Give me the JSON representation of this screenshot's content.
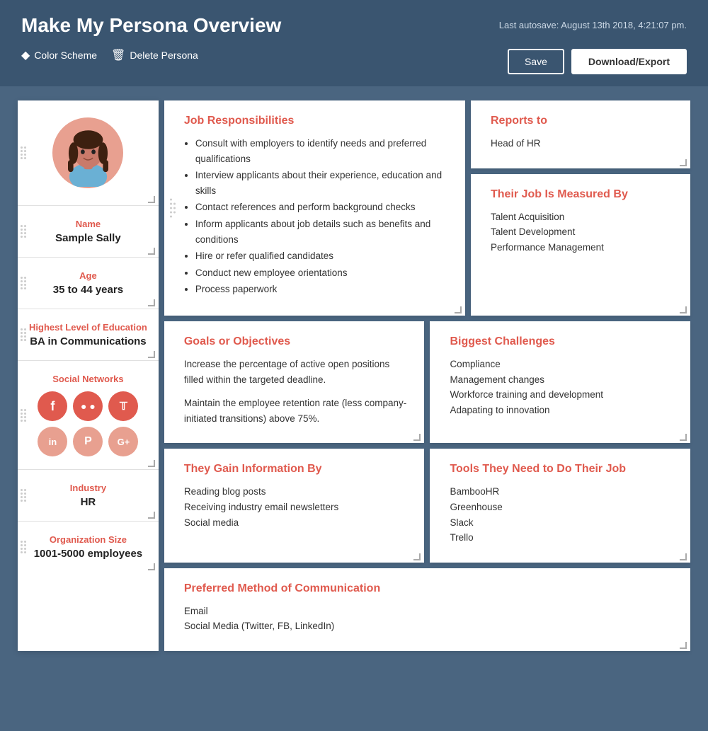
{
  "header": {
    "title": "Make My Persona Overview",
    "autosave": "Last autosave: August 13th 2018, 4:21:07 pm.",
    "color_scheme_label": "Color Scheme",
    "delete_persona_label": "Delete Persona",
    "save_button": "Save",
    "download_button": "Download/Export"
  },
  "persona": {
    "name_label": "Name",
    "name_value": "Sample Sally",
    "age_label": "Age",
    "age_value": "35 to 44 years",
    "education_label": "Highest Level of Education",
    "education_value": "BA in Communications",
    "social_label": "Social Networks",
    "social_icons": [
      "f",
      "&#x1D4F8;",
      "&#x1D54B;",
      "in",
      "&#x1D4C5;",
      "G+"
    ],
    "industry_label": "Industry",
    "industry_value": "HR",
    "org_size_label": "Organization Size",
    "org_size_value": "1001-5000 employees"
  },
  "job_responsibilities": {
    "title": "Job Responsibilities",
    "items": [
      "Consult with employers to identify needs and preferred qualifications",
      "Interview applicants about their experience, education and skills",
      "Contact references and perform background checks",
      "Inform applicants about job details such as benefits and conditions",
      "Hire or refer qualified candidates",
      "Conduct new employee orientations",
      "Process paperwork"
    ]
  },
  "reports_to": {
    "title": "Reports to",
    "value": "Head of HR"
  },
  "measured_by": {
    "title": "Their Job Is Measured By",
    "items": [
      "Talent Acquisition",
      "Talent Development",
      "Performance Management"
    ]
  },
  "goals": {
    "title": "Goals or Objectives",
    "paragraphs": [
      "Increase the percentage of active open positions filled within the targeted deadline.",
      "Maintain the employee retention rate (less company-initiated transitions) above 75%."
    ]
  },
  "challenges": {
    "title": "Biggest Challenges",
    "items": [
      "Compliance",
      "Management changes",
      "Workforce training and development",
      "Adapating to innovation"
    ]
  },
  "gain_info": {
    "title": "They Gain Information By",
    "items": [
      "Reading blog posts",
      "Receiving industry email newsletters",
      "Social media"
    ]
  },
  "tools": {
    "title": "Tools They Need to Do Their Job",
    "items": [
      "BambooHR",
      "Greenhouse",
      "Slack",
      "Trello"
    ]
  },
  "communication": {
    "title": "Preferred Method of Communication",
    "items": [
      "Email",
      "Social Media (Twitter, FB, LinkedIn)"
    ]
  }
}
